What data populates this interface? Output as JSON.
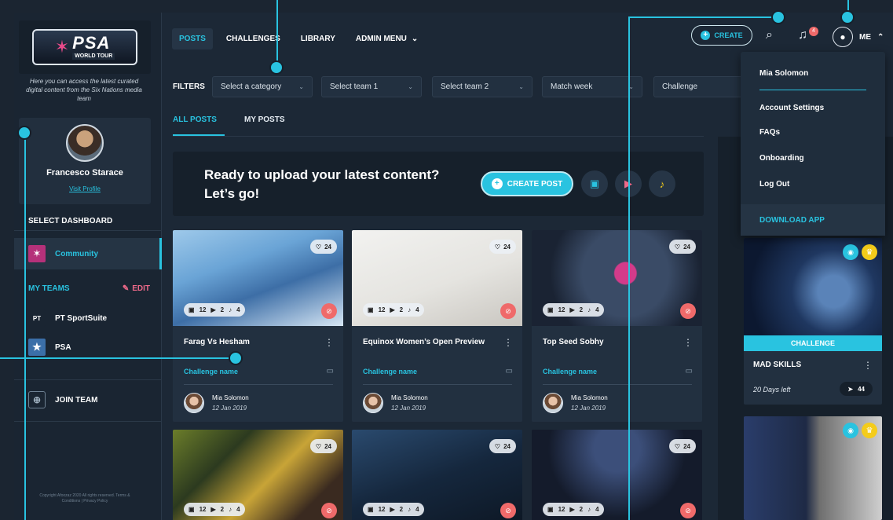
{
  "brand": {
    "logo_main": "PSA",
    "logo_sub": "WORLD TOUR",
    "tagline": "Here you can access the latest curated digital content from the Six Nations media team"
  },
  "profile": {
    "name": "Francesco Starace",
    "link": "Visit Profile"
  },
  "sidebar": {
    "select_dashboard": "SELECT DASHBOARD",
    "community": "Community",
    "my_teams": "MY TEAMS",
    "edit": "EDIT",
    "teams": [
      {
        "label": "PT SportSuite",
        "icon_text": "PT"
      },
      {
        "label": "PSA",
        "icon_text": "★"
      }
    ],
    "join_team": "JOIN TEAM",
    "copyright": "Copyright Afoozaz 2020 All rights reserved. Terms & Conditions | Privacy Policy"
  },
  "topnav": {
    "items": [
      "POSTS",
      "CHALLENGES",
      "LIBRARY",
      "ADMIN MENU"
    ],
    "create": "CREATE",
    "notifications_count": "4",
    "me": "ME"
  },
  "filters": {
    "label": "FILTERS",
    "selects": [
      "Select a category",
      "Select team 1",
      "Select team 2",
      "Match week",
      "Challenge"
    ]
  },
  "tabs": [
    "ALL POSTS",
    "MY POSTS"
  ],
  "upload": {
    "line1": "Ready to upload your latest content?",
    "line2": "Let’s go!",
    "create_post": "CREATE POST"
  },
  "posts": [
    {
      "title": "Farag Vs Hesham",
      "likes": "24",
      "images": "12",
      "videos": "2",
      "audio": "4",
      "challenge": "Challenge name",
      "author": "Mia Solomon",
      "date": "12 Jan 2019"
    },
    {
      "title": "Equinox Women’s Open Preview",
      "likes": "24",
      "images": "12",
      "videos": "2",
      "audio": "4",
      "challenge": "Challenge name",
      "author": "Mia Solomon",
      "date": "12 Jan 2019"
    },
    {
      "title": "Top Seed Sobhy",
      "likes": "24",
      "images": "12",
      "videos": "2",
      "audio": "4",
      "challenge": "Challenge name",
      "author": "Mia Solomon",
      "date": "12 Jan 2019"
    },
    {
      "likes": "24",
      "images": "12",
      "videos": "2",
      "audio": "4"
    },
    {
      "likes": "24",
      "images": "12",
      "videos": "2",
      "audio": "4"
    },
    {
      "likes": "24",
      "images": "12",
      "videos": "2",
      "audio": "4"
    }
  ],
  "dropdown": {
    "user": "Mia Solomon",
    "items": [
      "Account Settings",
      "FAQs",
      "Onboarding",
      "Log Out"
    ],
    "download": "DOWNLOAD APP"
  },
  "challenge_card": {
    "banner": "CHALLENGE",
    "title": "MAD SKILLS",
    "days_left": "20 Days left",
    "count": "44"
  },
  "colors": {
    "accent": "#29c3e0",
    "danger": "#ef6a6a",
    "gold": "#f4cc1a",
    "panel": "#223040"
  }
}
